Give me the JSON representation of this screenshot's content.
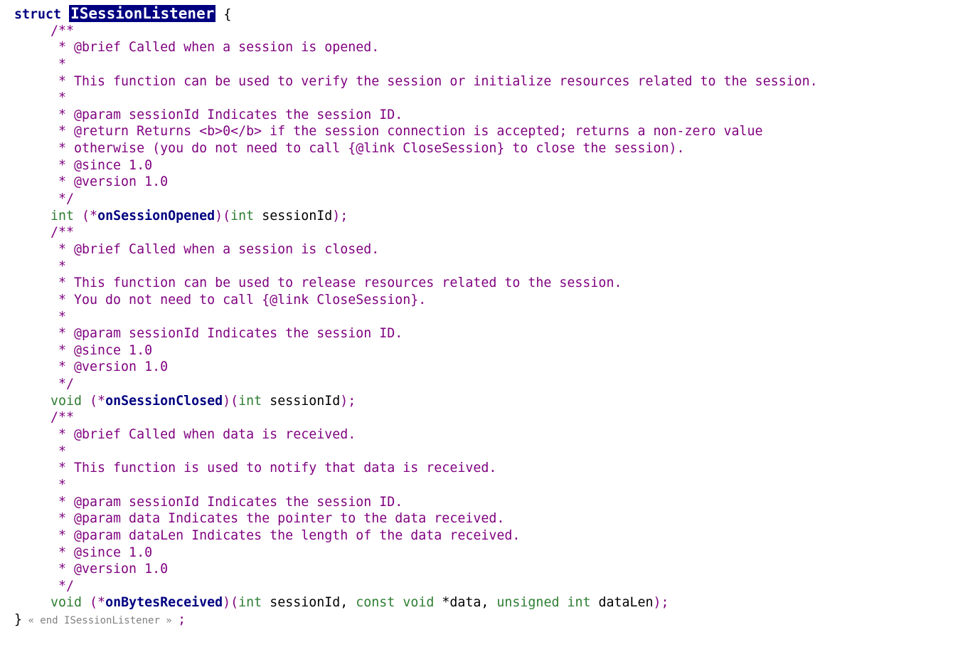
{
  "code": {
    "struct_keyword": "struct",
    "struct_name": "ISessionListener",
    "open_brace": " {",
    "lines": [
      "/**",
      " * @brief Called when a session is opened.",
      " *",
      " * This function can be used to verify the session or initialize resources related to the session.",
      " *",
      " * @param sessionId Indicates the session ID.",
      " * @return Returns <b>0</b> if the session connection is accepted; returns a non-zero value",
      " * otherwise (you do not need to call {@link CloseSession} to close the session).",
      " * @since 1.0",
      " * @version 1.0",
      " */",
      "/**",
      " * @brief Called when a session is closed.",
      " *",
      " * This function can be used to release resources related to the session.",
      " * You do not need to call {@link CloseSession}.",
      " *",
      " * @param sessionId Indicates the session ID.",
      " * @since 1.0",
      " * @version 1.0",
      " */",
      "/**",
      " * @brief Called when data is received.",
      " *",
      " * This function is used to notify that data is received.",
      " *",
      " * @param sessionId Indicates the session ID.",
      " * @param data Indicates the pointer to the data received.",
      " * @param dataLen Indicates the length of the data received.",
      " * @since 1.0",
      " * @version 1.0",
      " */"
    ],
    "decl1": {
      "type": "int",
      "open": " (*",
      "name": "onSessionOpened",
      "params_open": ")(",
      "p1_type": "int",
      "p1_name": " sessionId",
      "close": ");"
    },
    "decl2": {
      "type": "void",
      "open": " (*",
      "name": "onSessionClosed",
      "params_open": ")(",
      "p1_type": "int",
      "p1_name": " sessionId",
      "close": ");"
    },
    "decl3": {
      "type": "void",
      "open": " (*",
      "name": "onBytesReceived",
      "params_open": ")(",
      "p1_type": "int",
      "p1_name": " sessionId, ",
      "p2_type": "const void",
      "p2_name": " *data, ",
      "p3_type": "unsigned int",
      "p3_name": " dataLen",
      "close": ");"
    },
    "close_brace": "}",
    "end_marker": " « end ISessionListener » ",
    "semicolon": ";"
  },
  "colors": {
    "keyword": "#000080",
    "comment": "#7f007f",
    "type": "#2e7d32",
    "highlight_bg": "#000080"
  }
}
